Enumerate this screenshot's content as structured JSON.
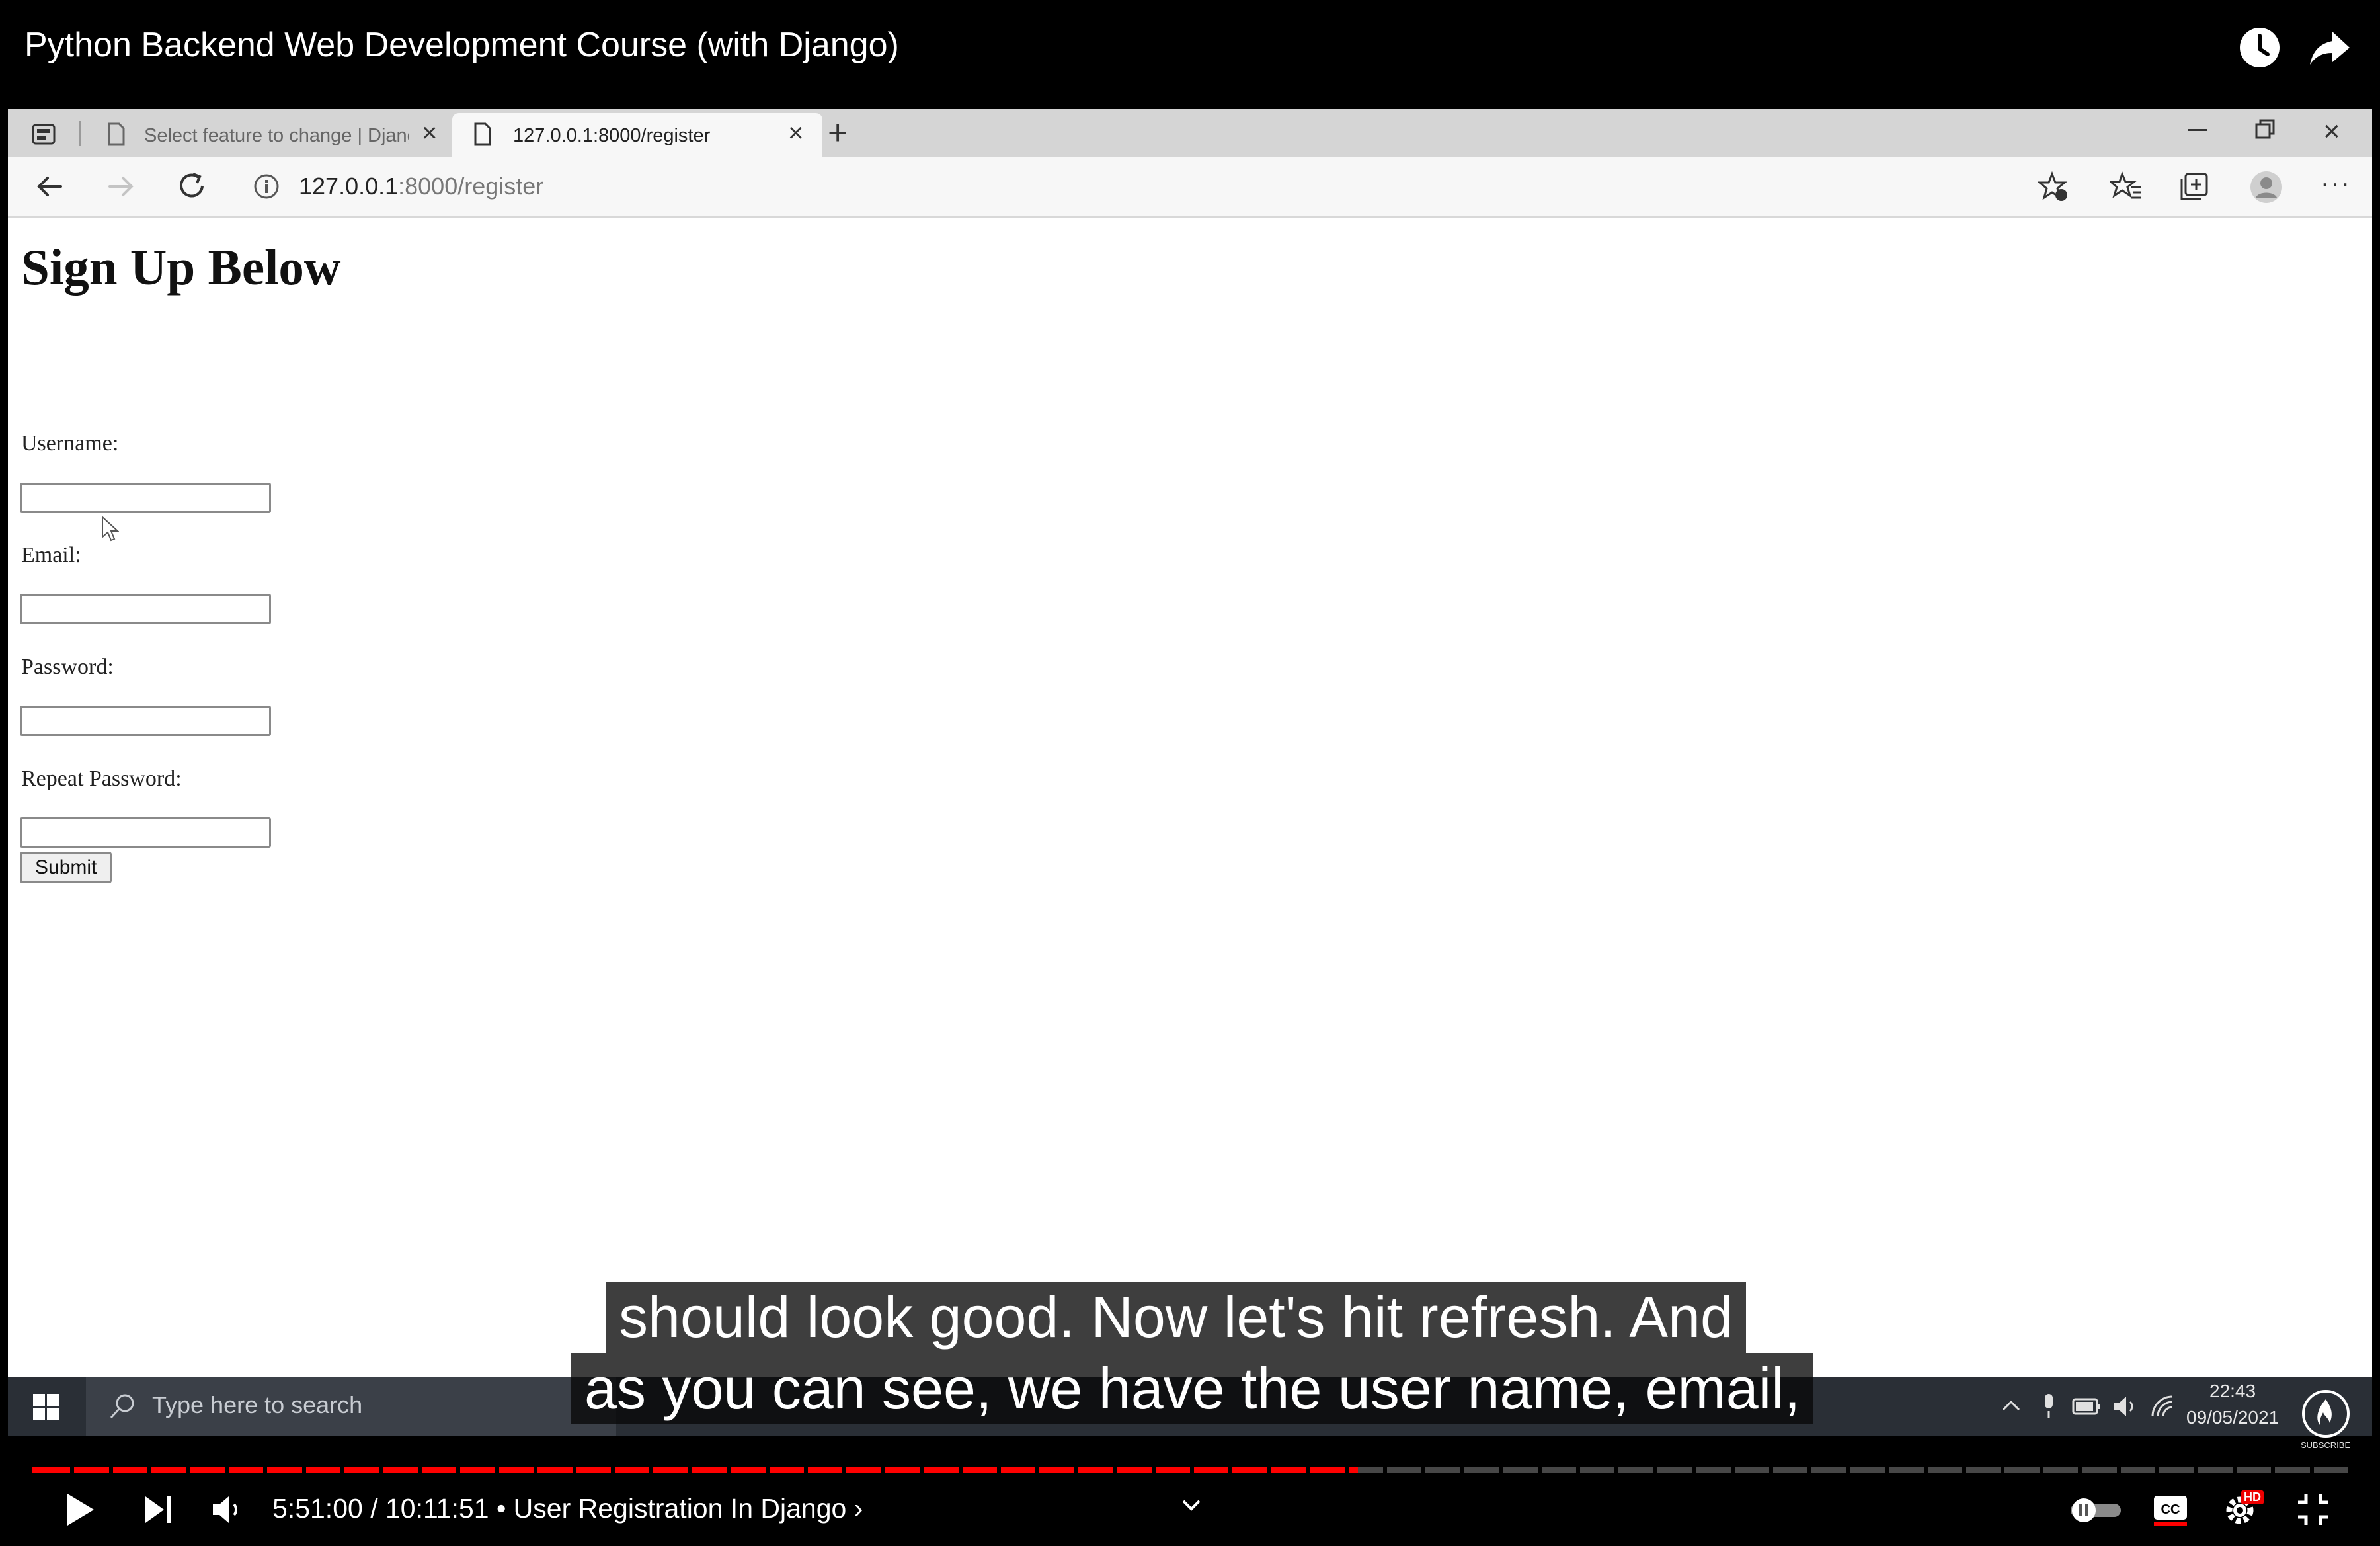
{
  "video": {
    "title": "Python Backend Web Development Course (with Django)",
    "time_current": "5:51:00",
    "time_separator": " / ",
    "time_total": "10:11:51",
    "chapter": " • User Registration In Django ›",
    "progress_fraction": 0.5726,
    "hd_badge": "HD",
    "subscribe_label": "SUBSCRIBE",
    "colors": {
      "progress": "#ff0000",
      "background": "#000000"
    }
  },
  "captions": {
    "line1": "should look good. Now let's hit refresh. And",
    "line2": "as you can see, we have the user name, email,"
  },
  "browser": {
    "tabs": [
      {
        "label": "Select feature to change | Django",
        "active": false
      },
      {
        "label": "127.0.0.1:8000/register",
        "active": true
      }
    ],
    "url_host": "127.0.0.1",
    "url_path": ":8000/register"
  },
  "page": {
    "title": "Sign Up Below",
    "fields": [
      {
        "label": "Username:",
        "value": ""
      },
      {
        "label": "Email:",
        "value": ""
      },
      {
        "label": "Password:",
        "value": ""
      },
      {
        "label": "Repeat Password:",
        "value": ""
      }
    ],
    "submit_label": "Submit"
  },
  "taskbar": {
    "search_placeholder": "Type here to search",
    "time": "22:43",
    "date": "09/05/2021"
  }
}
